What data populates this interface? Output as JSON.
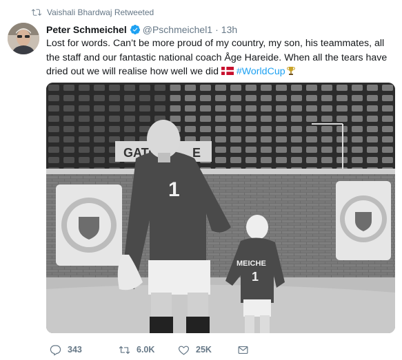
{
  "retweet_banner": {
    "text": "Vaishali Bhardwaj Retweeted",
    "icon": "retweet-icon"
  },
  "tweet": {
    "author_name": "Peter Schmeichel",
    "verified": true,
    "handle": "@Pschmeichel1",
    "separator": "·",
    "time": "13h",
    "text_main": "Lost for words. Can’t be more proud of my country, my son, his teammates, all the staff and our fantastic national coach Åge Hareide. When all the tears have dried out we will realise how well we did",
    "hashtag": "#WorldCup",
    "emoji": [
      "denmark-flag",
      "trophy-icon"
    ]
  },
  "media": {
    "photo_text": {
      "sign": "GATOR",
      "sign_tail": "E",
      "goalkeeper_shirt": "1",
      "child_shirt_number": "1",
      "child_shirt_name": "MEICHE"
    }
  },
  "actions": {
    "reply_count": "343",
    "retweet_count": "6.0K",
    "like_count": "25K"
  },
  "colors": {
    "text_primary": "#14171a",
    "text_secondary": "#657786",
    "link": "#1da1f2",
    "verified": "#1da1f2"
  }
}
